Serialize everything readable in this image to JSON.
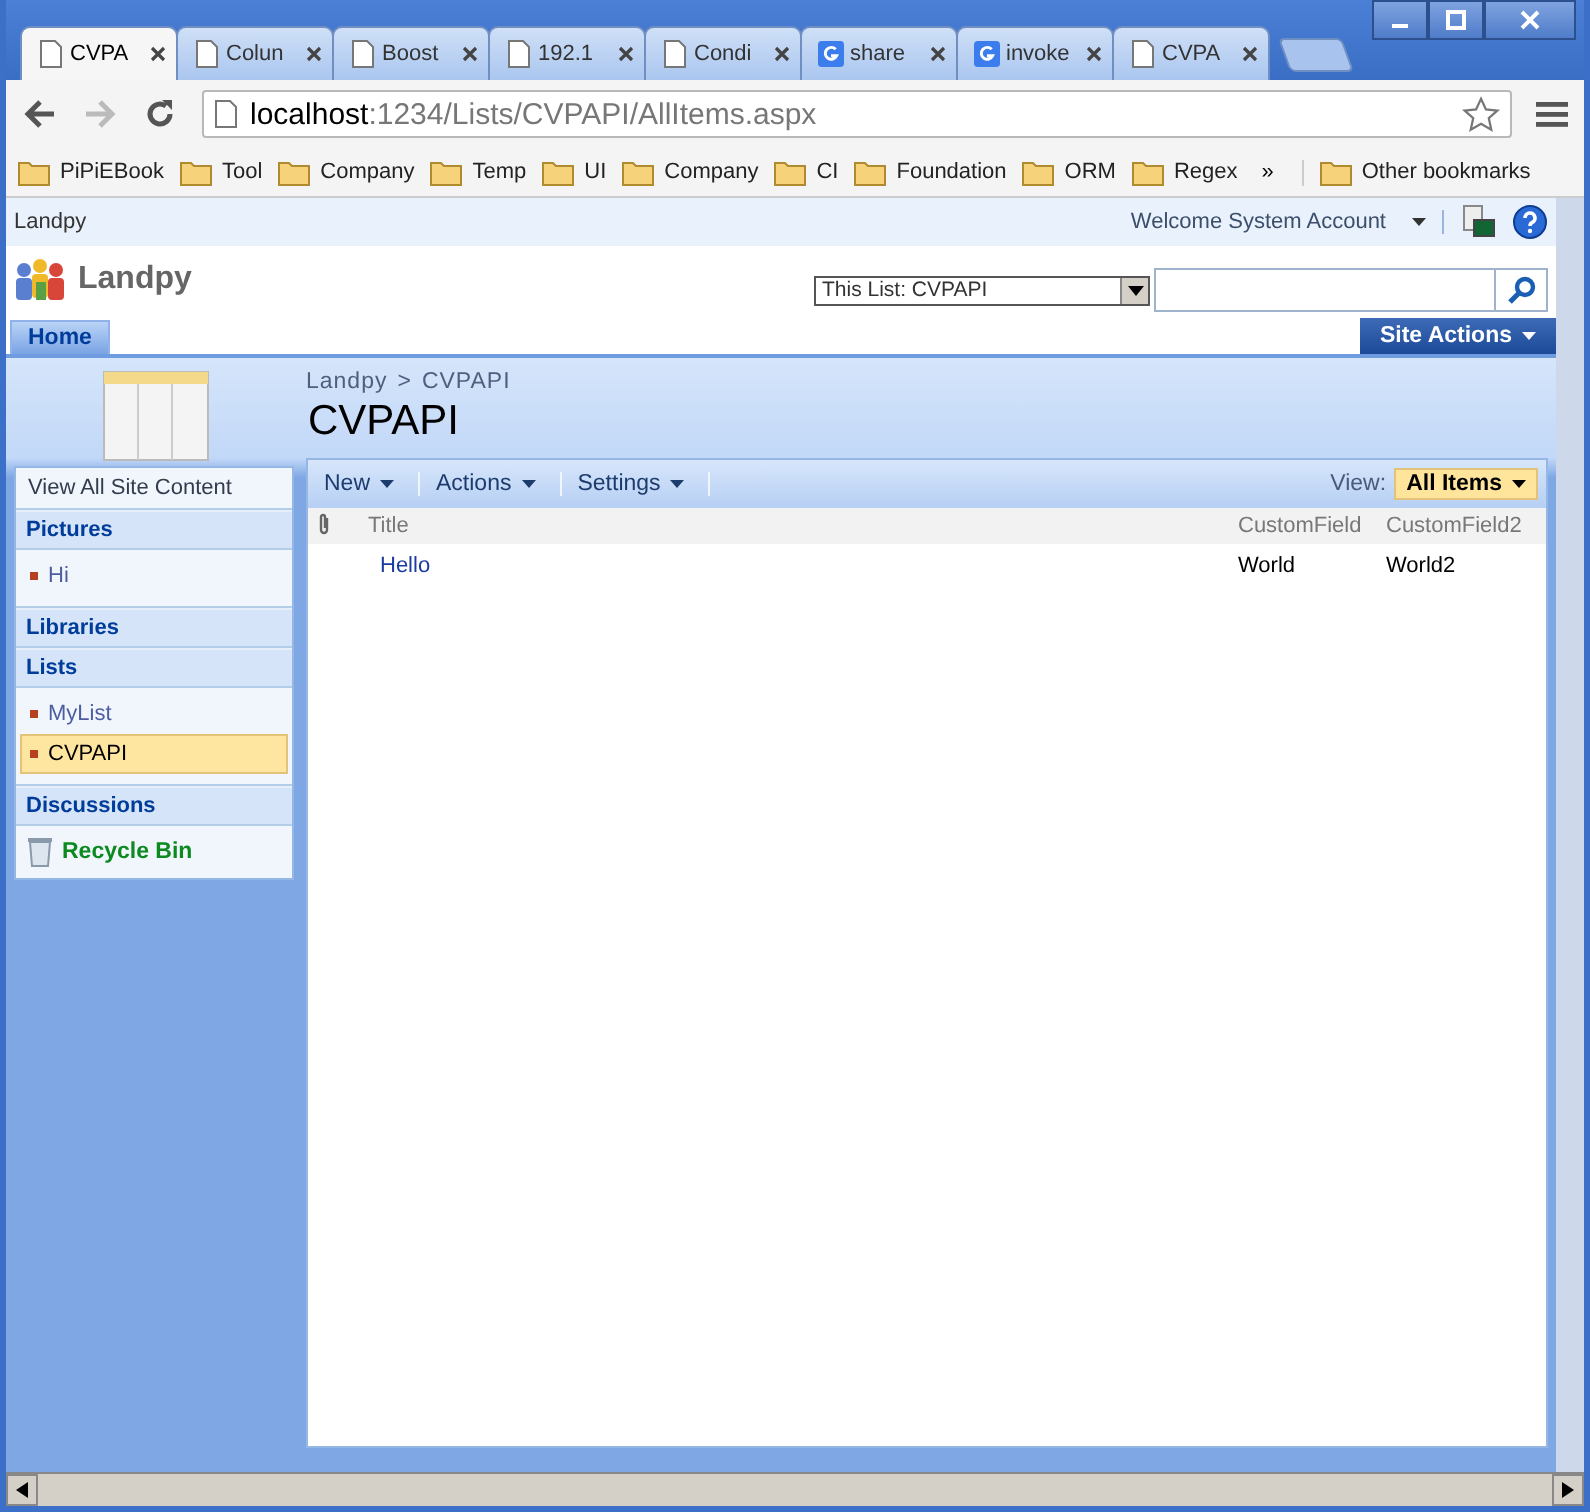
{
  "browser": {
    "tabs": [
      {
        "title": "CVPA",
        "kind": "page",
        "selected": true
      },
      {
        "title": "Colun",
        "kind": "page",
        "selected": false
      },
      {
        "title": "Boost",
        "kind": "page",
        "selected": false
      },
      {
        "title": "192.1",
        "kind": "page",
        "selected": false
      },
      {
        "title": "Condi",
        "kind": "page",
        "selected": false
      },
      {
        "title": "share",
        "kind": "google",
        "selected": false
      },
      {
        "title": "invoke",
        "kind": "google",
        "selected": false
      },
      {
        "title": "CVPA",
        "kind": "page",
        "selected": false
      }
    ],
    "url": {
      "host": "localhost",
      "path": ":1234/Lists/CVPAPI/AllItems.aspx"
    },
    "bookmarks": [
      "PiPiEBook",
      "Tool",
      "Company",
      "Temp",
      "UI",
      "Company",
      "CI",
      "Foundation",
      "ORM",
      "Regex"
    ],
    "bookmarks_overflow": "»",
    "other_bookmarks": "Other bookmarks"
  },
  "site": {
    "top_bar": {
      "site": "Landpy",
      "welcome": "Welcome System Account"
    },
    "title": "Landpy",
    "search": {
      "scope": "This List: CVPAPI"
    },
    "nav_tabs": [
      {
        "label": "Home",
        "selected": true
      }
    ],
    "site_actions": "Site Actions",
    "breadcrumb": {
      "parent": "Landpy",
      "separator": ">",
      "current": "CVPAPI"
    },
    "page_title": "CVPAPI"
  },
  "quick_launch": {
    "view_all": "View All Site Content",
    "sections": [
      {
        "heading": "Pictures",
        "items": [
          {
            "label": "Hi",
            "selected": false
          }
        ]
      },
      {
        "heading": "Libraries"
      },
      {
        "heading": "Lists",
        "items": [
          {
            "label": "MyList",
            "selected": false
          },
          {
            "label": "CVPAPI",
            "selected": true
          }
        ]
      },
      {
        "heading": "Discussions"
      }
    ],
    "recycle_bin": "Recycle Bin"
  },
  "list_toolbar": {
    "menus": [
      "New",
      "Actions",
      "Settings"
    ],
    "view_label": "View:",
    "view": "All Items"
  },
  "table": {
    "columns": [
      "Title",
      "CustomField",
      "CustomField2"
    ],
    "rows": [
      [
        "Hello",
        "World",
        "World2"
      ]
    ]
  }
}
